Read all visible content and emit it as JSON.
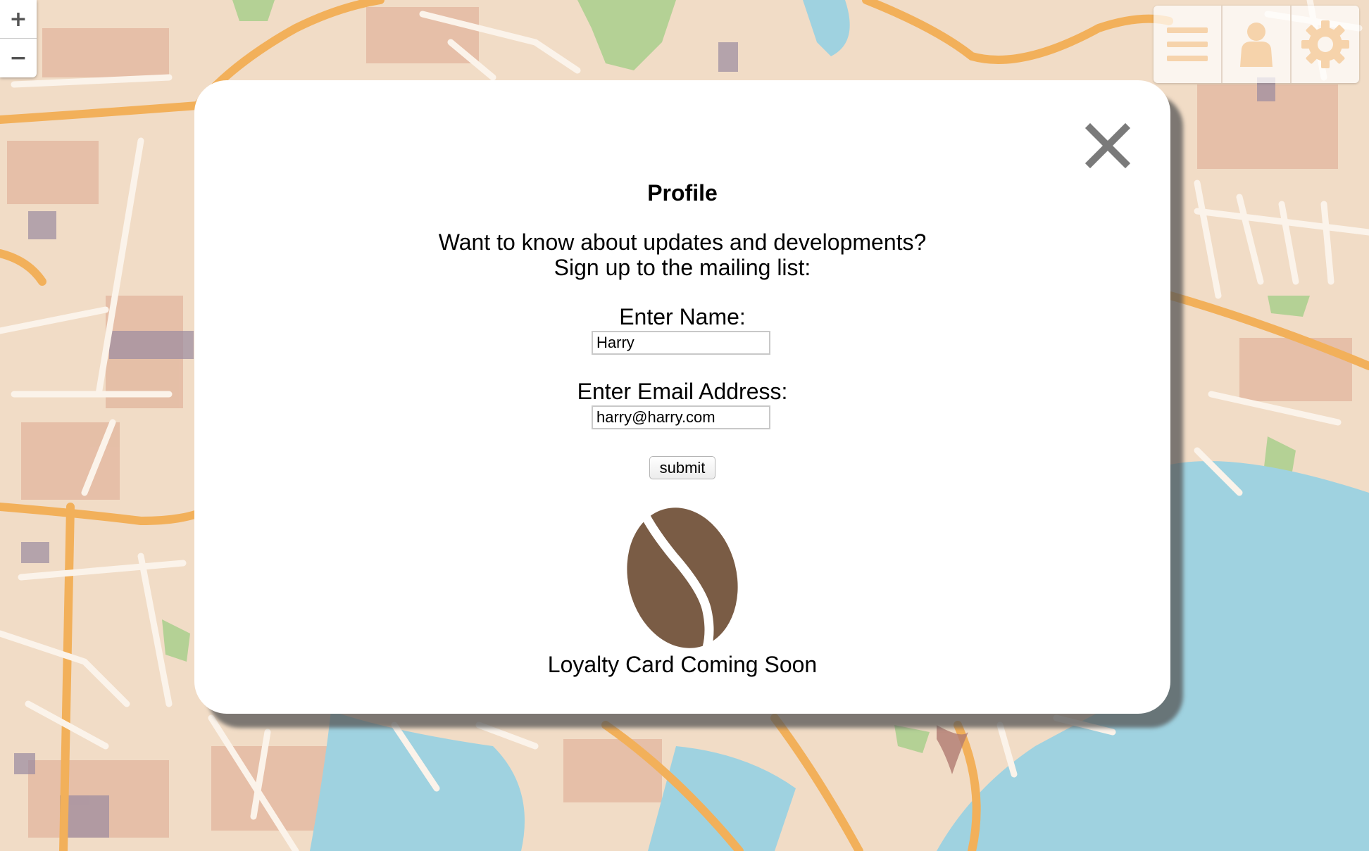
{
  "map": {
    "zoom_in_label": "+",
    "zoom_out_label": "−"
  },
  "toolbar": {
    "items": [
      {
        "icon": "hamburger-menu-icon"
      },
      {
        "icon": "user-profile-icon"
      },
      {
        "icon": "gear-icon"
      }
    ],
    "icon_color": "#f6d3ab"
  },
  "profile_modal": {
    "title": "Profile",
    "intro_line1": "Want to know about updates and developments?",
    "intro_line2": "Sign up to the mailing list:",
    "name_label": "Enter Name:",
    "name_value": "Harry",
    "email_label": "Enter Email Address:",
    "email_value": "harry@harry.com",
    "submit_label": "submit",
    "close_icon": "close-icon",
    "loyalty_icon": "coffee-bean-icon",
    "loyalty_text": "Loyalty Card Coming Soon",
    "bean_color": "#7a5c45"
  }
}
